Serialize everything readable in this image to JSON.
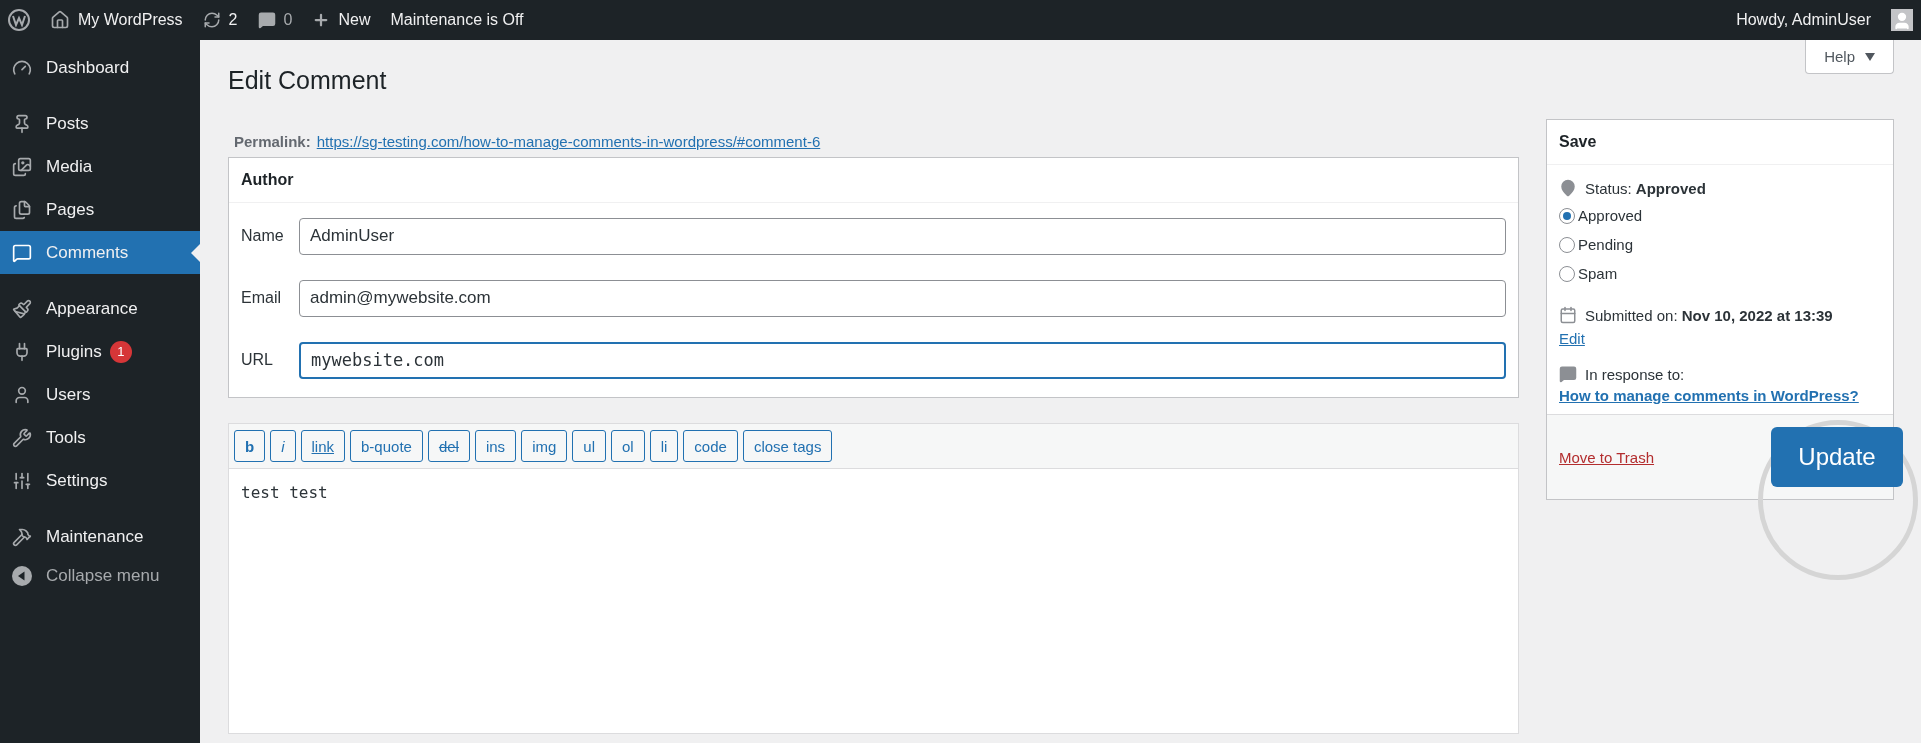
{
  "top_bar": {
    "site": "My WordPress",
    "updates": "2",
    "comments": "0",
    "new": "New",
    "maintenance": "Maintenance is Off",
    "greeting": "Howdy, AdminUser"
  },
  "sidebar": {
    "groups": [
      {
        "items": [
          {
            "label": "Dashboard",
            "selected": false
          }
        ]
      },
      {
        "items": [
          {
            "label": "Posts",
            "selected": false
          },
          {
            "label": "Media",
            "selected": false
          },
          {
            "label": "Pages",
            "selected": false
          },
          {
            "label": "Comments",
            "selected": true
          }
        ]
      },
      {
        "items": [
          {
            "label": "Appearance",
            "selected": false
          },
          {
            "label": "Plugins",
            "selected": false,
            "badge": "1"
          },
          {
            "label": "Users",
            "selected": false
          },
          {
            "label": "Tools",
            "selected": false
          },
          {
            "label": "Settings",
            "selected": false
          }
        ]
      },
      {
        "items": [
          {
            "label": "Maintenance",
            "selected": false
          }
        ]
      }
    ],
    "collapse": "Collapse menu"
  },
  "help": "Help",
  "title": "Edit Comment",
  "permalink": {
    "label": "Permalink:",
    "url": "https://sg-testing.com/how-to-manage-comments-in-wordpress/#comment-6"
  },
  "author": {
    "title": "Author",
    "fields": [
      {
        "label": "Name",
        "value": "AdminUser",
        "focused": false
      },
      {
        "label": "Email",
        "value": "admin@mywebsite.com",
        "focused": false
      },
      {
        "label": "URL",
        "value": "mywebsite.com",
        "focused": true
      }
    ]
  },
  "editor": {
    "buttons": [
      {
        "label": "b",
        "kind": "bold"
      },
      {
        "label": "i",
        "kind": "italic"
      },
      {
        "label": "link",
        "kind": "underline"
      },
      {
        "label": "b-quote",
        "kind": "plain"
      },
      {
        "label": "del",
        "kind": "strike"
      },
      {
        "label": "ins",
        "kind": "plain"
      },
      {
        "label": "img",
        "kind": "plain"
      },
      {
        "label": "ul",
        "kind": "plain"
      },
      {
        "label": "ol",
        "kind": "plain"
      },
      {
        "label": "li",
        "kind": "plain"
      },
      {
        "label": "code",
        "kind": "plain"
      },
      {
        "label": "close tags",
        "kind": "plain"
      }
    ],
    "content": "test test"
  },
  "save": {
    "title": "Save",
    "status": "Status: **Approved**",
    "options": [
      {
        "label": "Approved",
        "selected": true
      },
      {
        "label": "Pending",
        "selected": false
      },
      {
        "label": "Spam",
        "selected": false
      }
    ],
    "submitted": "Submitted on: **Nov 10, 2022 at 13:39**",
    "edit": "Edit",
    "response_label": "In response to:",
    "response_link": "How to manage comments in WordPress?",
    "trash": "Move to Trash",
    "update": "Update"
  }
}
